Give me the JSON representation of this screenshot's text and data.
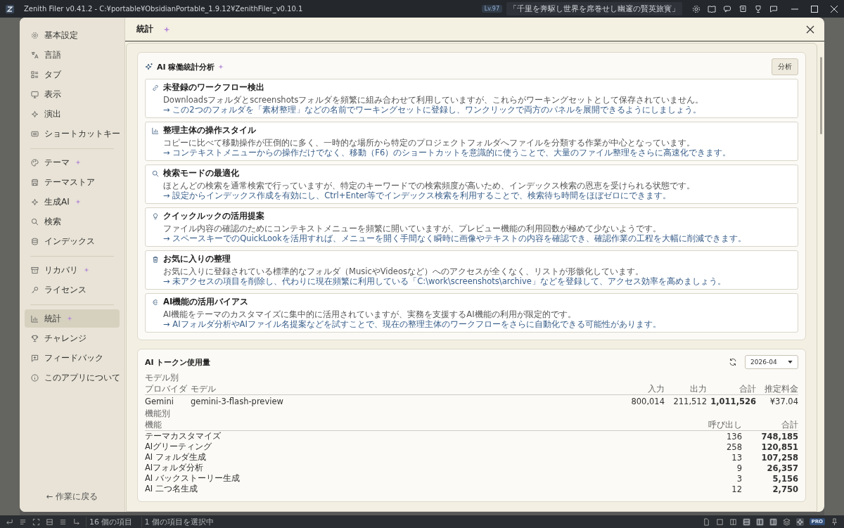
{
  "window": {
    "title": "Zenith Filer v0.41.2 - C:¥portable¥ObsidianPortable_1.9.12¥ZenithFiler_v0.10.1",
    "level": "Lv.97",
    "motto": "「千里を奔駆し世界を席巻せし幽邃の賢英旅寳」"
  },
  "sidebar": {
    "groups": [
      [
        {
          "label": "基本設定",
          "sparkle": false,
          "selected": false
        },
        {
          "label": "言語",
          "sparkle": false,
          "selected": false
        },
        {
          "label": "タブ",
          "sparkle": false,
          "selected": false
        },
        {
          "label": "表示",
          "sparkle": false,
          "selected": false
        },
        {
          "label": "演出",
          "sparkle": false,
          "selected": false
        },
        {
          "label": "ショートカットキー",
          "sparkle": false,
          "selected": false
        }
      ],
      [
        {
          "label": "テーマ",
          "sparkle": true,
          "selected": false
        },
        {
          "label": "テーマストア",
          "sparkle": false,
          "selected": false
        },
        {
          "label": "生成AI",
          "sparkle": true,
          "selected": false
        },
        {
          "label": "検索",
          "sparkle": false,
          "selected": false
        },
        {
          "label": "インデックス",
          "sparkle": false,
          "selected": false
        }
      ],
      [
        {
          "label": "リカバリ",
          "sparkle": true,
          "selected": false
        },
        {
          "label": "ライセンス",
          "sparkle": false,
          "selected": false
        }
      ],
      [
        {
          "label": "統計",
          "sparkle": true,
          "selected": true
        },
        {
          "label": "チャレンジ",
          "sparkle": false,
          "selected": false
        },
        {
          "label": "フィードバック",
          "sparkle": false,
          "selected": false
        },
        {
          "label": "このアプリについて",
          "sparkle": false,
          "selected": false
        }
      ]
    ],
    "back": "← 作業に戻る"
  },
  "page": {
    "title": "統計",
    "sparkle": true
  },
  "analysis": {
    "title": "AI 稼働統計分析",
    "sparkle": true,
    "button": "分析",
    "cards": [
      {
        "title": "未登録のワークフロー検出",
        "text": "Downloadsフォルダとscreenshotsフォルダを頻繁に組み合わせて利用していますが、これらがワーキングセットとして保存されていません。",
        "advice": "→ この2つのフォルダを「素材整理」などの名前でワーキングセットに登録し、ワンクリックで両方のパネルを展開できるようにしましょう。"
      },
      {
        "title": "整理主体の操作スタイル",
        "text": "コピーに比べて移動操作が圧倒的に多く、一時的な場所から特定のプロジェクトフォルダへファイルを分類する作業が中心となっています。",
        "advice": "→ コンテキストメニューからの操作だけでなく、移動（F6）のショートカットを意識的に使うことで、大量のファイル整理をさらに高速化できます。"
      },
      {
        "title": "検索モードの最適化",
        "text": "ほとんどの検索を通常検索で行っていますが、特定のキーワードでの検索頻度が高いため、インデックス検索の恩恵を受けられる状態です。",
        "advice": "→ 設定からインデックス作成を有効にし、Ctrl+Enter等でインデックス検索を利用することで、検索待ち時間をほぼゼロにできます。"
      },
      {
        "title": "クイックルックの活用提案",
        "text": "ファイル内容の確認のためにコンテキストメニューを頻繁に開いていますが、プレビュー機能の利用回数が極めて少ないようです。",
        "advice": "→ スペースキーでのQuickLookを活用すれば、メニューを開く手間なく瞬時に画像やテキストの内容を確認でき、確認作業の工程を大幅に削減できます。"
      },
      {
        "title": "お気に入りの整理",
        "text": "お気に入りに登録されている標準的なフォルダ（MusicやVideosなど）へのアクセスが全くなく、リストが形骸化しています。",
        "advice": "→ 未アクセスの項目を削除し、代わりに現在頻繁に利用している「C:\\work\\screenshots\\archive」などを登録して、アクセス効率を高めましょう。"
      },
      {
        "title": "AI機能の活用バイアス",
        "text": "AI機能をテーマのカスタマイズに集中的に活用されていますが、実務を支援するAI機能の利用が限定的です。",
        "advice": "→ AIフォルダ分析やAIファイル名提案などを試すことで、現在の整理主体のワークフローをさらに自動化できる可能性があります。"
      }
    ]
  },
  "tokens": {
    "title": "AI トークン使用量",
    "month": "2026-04",
    "by_model": {
      "heading": "モデル別",
      "columns": [
        "プロバイダ",
        "モデル",
        "入力",
        "出力",
        "合計",
        "推定料金"
      ],
      "rows": [
        [
          "Gemini",
          "gemini-3-flash-preview",
          "800,014",
          "211,512",
          "1,011,526",
          "¥37.04"
        ]
      ]
    },
    "by_feature": {
      "heading": "機能別",
      "columns": [
        "機能",
        "呼び出し",
        "合計"
      ],
      "rows": [
        [
          "テーマカスタマイズ",
          "136",
          "748,185"
        ],
        [
          "AIグリーティング",
          "258",
          "120,851"
        ],
        [
          "AI フォルダ生成",
          "13",
          "107,258"
        ],
        [
          "AIフォルダ分析",
          "9",
          "26,357"
        ],
        [
          "AI バックストーリー生成",
          "3",
          "5,156"
        ],
        [
          "AI 二つ名生成",
          "12",
          "2,750"
        ]
      ]
    }
  },
  "status_bar": {
    "count": "16 個の項目",
    "selection": "1 個の項目を選択中",
    "badge": "PRO"
  }
}
